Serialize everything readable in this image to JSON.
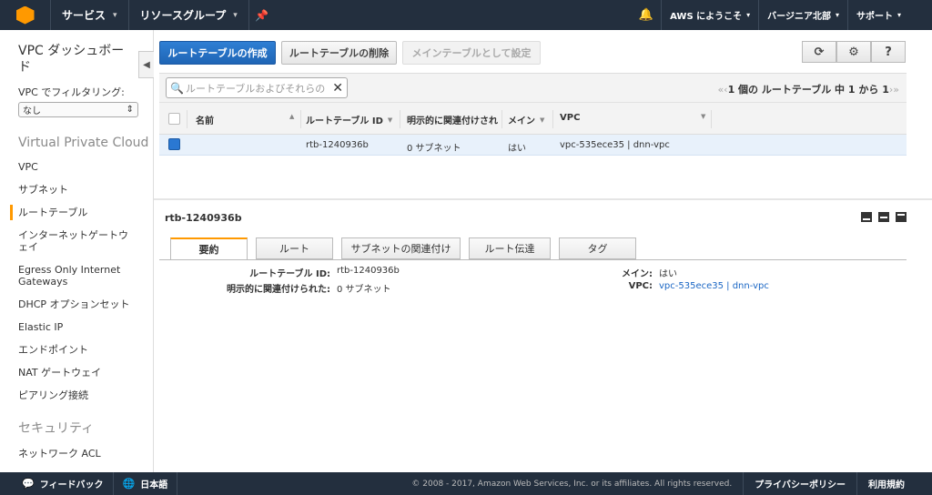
{
  "topnav": {
    "services": "サービス",
    "resource_groups": "リソースグループ",
    "user": "AWS にようこそ",
    "region": "バージニア北部",
    "support": "サポート"
  },
  "sidebar": {
    "title": "VPC ダッシュボード",
    "filter_label": "VPC でフィルタリング:",
    "filter_value": "なし",
    "section_vpc": "Virtual Private Cloud",
    "items": [
      {
        "label": "VPC"
      },
      {
        "label": "サブネット"
      },
      {
        "label": "ルートテーブル"
      },
      {
        "label": "インターネットゲートウェイ"
      },
      {
        "label": "Egress Only Internet Gateways"
      },
      {
        "label": "DHCP オプションセット"
      },
      {
        "label": "Elastic IP"
      },
      {
        "label": "エンドポイント"
      },
      {
        "label": "NAT ゲートウェイ"
      },
      {
        "label": "ピアリング接続"
      }
    ],
    "section_security": "セキュリティ",
    "security_items": [
      {
        "label": "ネットワーク ACL"
      }
    ]
  },
  "toolbar": {
    "create": "ルートテーブルの作成",
    "delete": "ルートテーブルの削除",
    "set_main": "メインテーブルとして設定"
  },
  "search": {
    "placeholder": "ルートテーブルおよびそれらの"
  },
  "pager": {
    "text": "1 個の ルートテーブル 中 1 から 1"
  },
  "table": {
    "headers": {
      "name": "名前",
      "id": "ルートテーブル ID",
      "assoc": "明示的に関連付けされた",
      "main": "メイン",
      "vpc": "VPC"
    },
    "rows": [
      {
        "name": "",
        "id": "rtb-1240936b",
        "assoc": "0 サブネット",
        "main": "はい",
        "vpc": "vpc-535ece35 | dnn-vpc"
      }
    ]
  },
  "detail": {
    "title": "rtb-1240936b",
    "tabs": [
      "要約",
      "ルート",
      "サブネットの関連付け",
      "ルート伝達",
      "タグ"
    ],
    "fields": {
      "id_label": "ルートテーブル ID:",
      "id_value": "rtb-1240936b",
      "assoc_label": "明示的に関連付けられた:",
      "assoc_value": "0 サブネット",
      "main_label": "メイン:",
      "main_value": "はい",
      "vpc_label": "VPC:",
      "vpc_value": "vpc-535ece35 | dnn-vpc"
    }
  },
  "footer": {
    "feedback": "フィードバック",
    "language": "日本語",
    "copyright": "© 2008 - 2017, Amazon Web Services, Inc. or its affiliates. All rights reserved.",
    "privacy": "プライバシーポリシー",
    "terms": "利用規約"
  }
}
